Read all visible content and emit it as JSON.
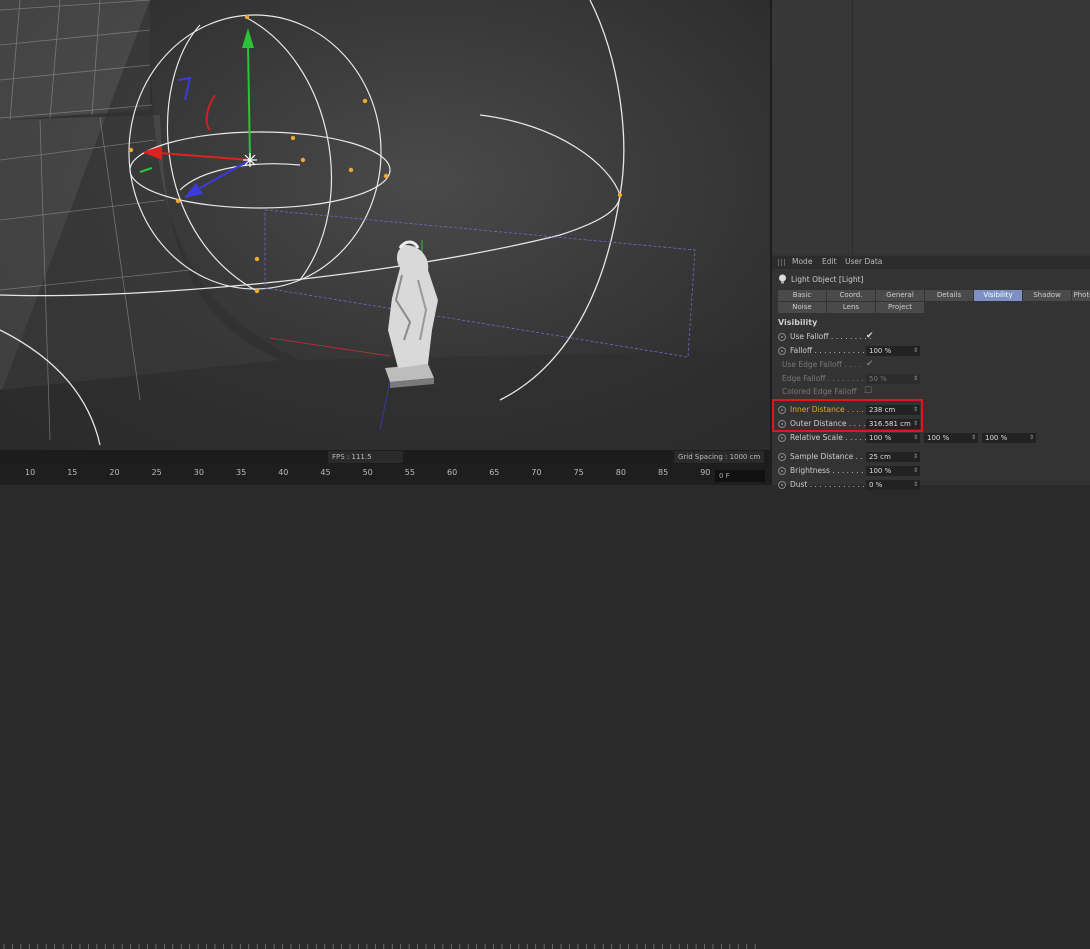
{
  "viewport": {
    "fps_text": "FPS : 111.5",
    "grid_spacing_text": "Grid Spacing : 1000 cm"
  },
  "timeline": {
    "ticks": [
      "10",
      "15",
      "20",
      "25",
      "30",
      "35",
      "40",
      "45",
      "50",
      "55",
      "60",
      "65",
      "70",
      "75",
      "80",
      "85",
      "90"
    ],
    "frame_field": "0 F"
  },
  "attribute_manager": {
    "menu": {
      "mode": "Mode",
      "edit": "Edit",
      "user_data": "User Data"
    },
    "object_title": "Light Object [Light]",
    "tabs_row1": [
      {
        "label": "Basic",
        "active": false
      },
      {
        "label": "Coord.",
        "active": false
      },
      {
        "label": "General",
        "active": false
      },
      {
        "label": "Details",
        "active": false
      },
      {
        "label": "Visibility",
        "active": true
      },
      {
        "label": "Shadow",
        "active": false
      },
      {
        "label": "Photo",
        "active": false
      }
    ],
    "tabs_row2": [
      {
        "label": "Noise",
        "active": false
      },
      {
        "label": "Lens",
        "active": false
      },
      {
        "label": "Project",
        "active": false
      }
    ],
    "section_title": "Visibility",
    "params": {
      "use_falloff": {
        "label": "Use Falloff . . . . . . . . .",
        "value": "✔"
      },
      "falloff": {
        "label": "Falloff . . . . . . . . . . . . .",
        "value": "100 %"
      },
      "use_edge_falloff": {
        "label": "Use Edge Falloff . . . .",
        "value": "✔"
      },
      "edge_falloff": {
        "label": "Edge Falloff . . . . . . . . .",
        "value": "50 %"
      },
      "colored_edge_falloff": {
        "label": "Colored Edge Falloff",
        "value": "☐"
      },
      "inner_distance": {
        "label": "Inner Distance . . . . .",
        "value": "238 cm"
      },
      "outer_distance": {
        "label": "Outer Distance . . . . .",
        "value": "316.581 cm"
      },
      "relative_scale": {
        "label": "Relative Scale . . . . .",
        "values": [
          "100 %",
          "100 %",
          "100 %"
        ]
      },
      "sample_distance": {
        "label": "Sample Distance . . . .",
        "value": "25 cm"
      },
      "brightness": {
        "label": "Brightness . . . . . . . . .",
        "value": "100 %"
      },
      "dust": {
        "label": "Dust . . . . . . . . . . . . . . .",
        "value": "0 %"
      }
    }
  },
  "colors": {
    "accent_tab": "#7d8fc4",
    "highlight": "#e5141b",
    "orange_label": "#e8a33a"
  }
}
